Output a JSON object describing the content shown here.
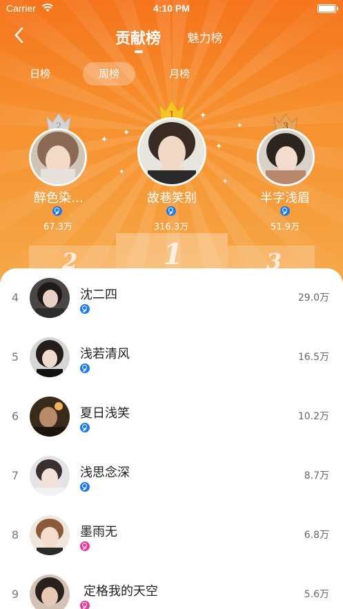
{
  "status_bar": {
    "carrier": "Carrier",
    "time": "4:10 PM"
  },
  "nav": {
    "active_tab": "贡献榜",
    "other_tab": "魅力榜"
  },
  "periods": {
    "day": "日榜",
    "week": "周榜",
    "month": "月榜",
    "selected": "周榜"
  },
  "podium": {
    "first": {
      "rank": "1",
      "name": "故巷笑别",
      "score": "316.3万",
      "badge": "blue"
    },
    "second": {
      "rank": "2",
      "name": "醉色染…",
      "score": "67.3万",
      "badge": "blue"
    },
    "third": {
      "rank": "3",
      "name": "半字浅眉",
      "score": "51.9万",
      "badge": "blue"
    }
  },
  "list": [
    {
      "rank": "4",
      "name": "沈二四",
      "score": "29.0万",
      "badge": "blue"
    },
    {
      "rank": "5",
      "name": "浅若清风",
      "score": "16.5万",
      "badge": "blue"
    },
    {
      "rank": "6",
      "name": "夏日浅笑",
      "score": "10.2万",
      "badge": "blue"
    },
    {
      "rank": "7",
      "name": "浅思念深",
      "score": "8.7万",
      "badge": "blue"
    },
    {
      "rank": "8",
      "name": "墨雨无",
      "score": "6.8万",
      "badge": "pink"
    },
    {
      "rank": "9",
      "name": "定格我的天空",
      "score": "5.6万",
      "badge": "pink"
    }
  ],
  "colors": {
    "accent": "#f5741c",
    "gold": "#f5c324",
    "silver": "#c9c9c9",
    "bronze": "#e0954a",
    "badge_blue": "#1d7bf0",
    "badge_pink": "#ea3b9c"
  }
}
